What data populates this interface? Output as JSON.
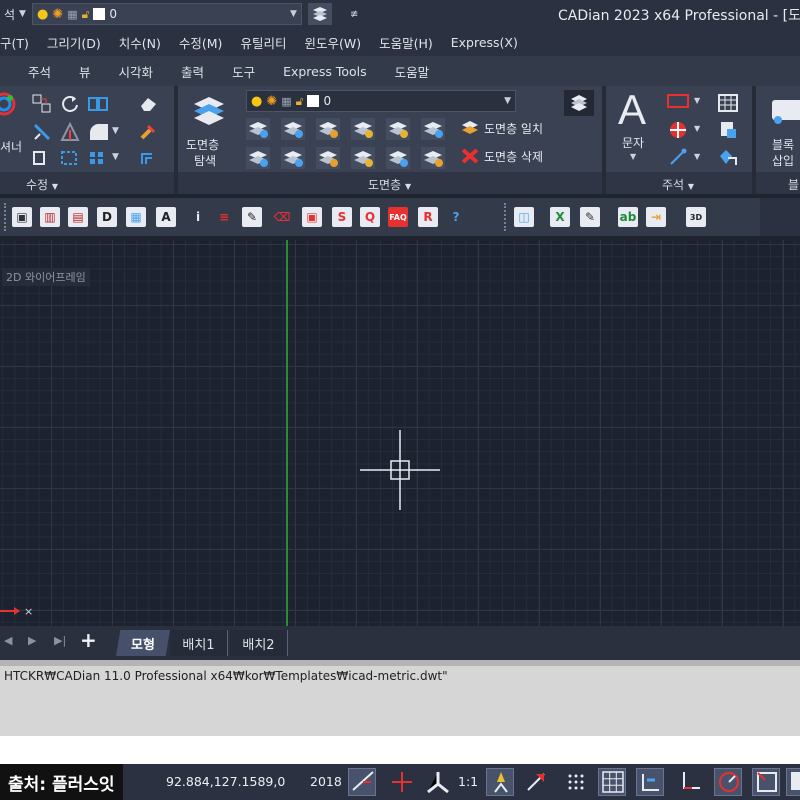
{
  "titlebar": {
    "layer_prefix": "석",
    "layer_value": "0",
    "app_title": "CADian 2023 x64 Professional - [도"
  },
  "menu": [
    "구(T)",
    "그리기(D)",
    "치수(N)",
    "수정(M)",
    "유틸리티",
    "윈도우(W)",
    "도움말(H)",
    "Express(X)"
  ],
  "ribbon_tabs": [
    "주석",
    "뷰",
    "시각화",
    "출력",
    "도구",
    "Express Tools",
    "도움말"
  ],
  "ribbon": {
    "modify_label": "수정",
    "modify_partial_text": "셔너",
    "layer_explorer_line1": "도면층",
    "layer_explorer_line2": "탐색",
    "layer_combo_value": "0",
    "layer_match": "도면층 일치",
    "layer_delete": "도면층 삭제",
    "layer_label": "도면층",
    "text_button": "문자",
    "text_icon": "A",
    "annotation_label": "주석",
    "block_line1": "블록",
    "block_line2": "삽입",
    "block_label_partial": "블"
  },
  "toolbar_labels": [
    "FAQ",
    "3D"
  ],
  "viewport_label": "2D 와이어프레임",
  "layout_tabs": {
    "model": "모형",
    "layout1": "배치1",
    "layout2": "배치2",
    "add": "+"
  },
  "command": {
    "history_line": "HTCKR₩CADian 11.0 Professional x64₩kor₩Templates₩icad-metric.dwt\"",
    "input_value": ""
  },
  "status": {
    "coordinates": "92.884,127.1589,0",
    "year": "2018",
    "scale": "1:1",
    "source": "출처: 플러스잇"
  }
}
